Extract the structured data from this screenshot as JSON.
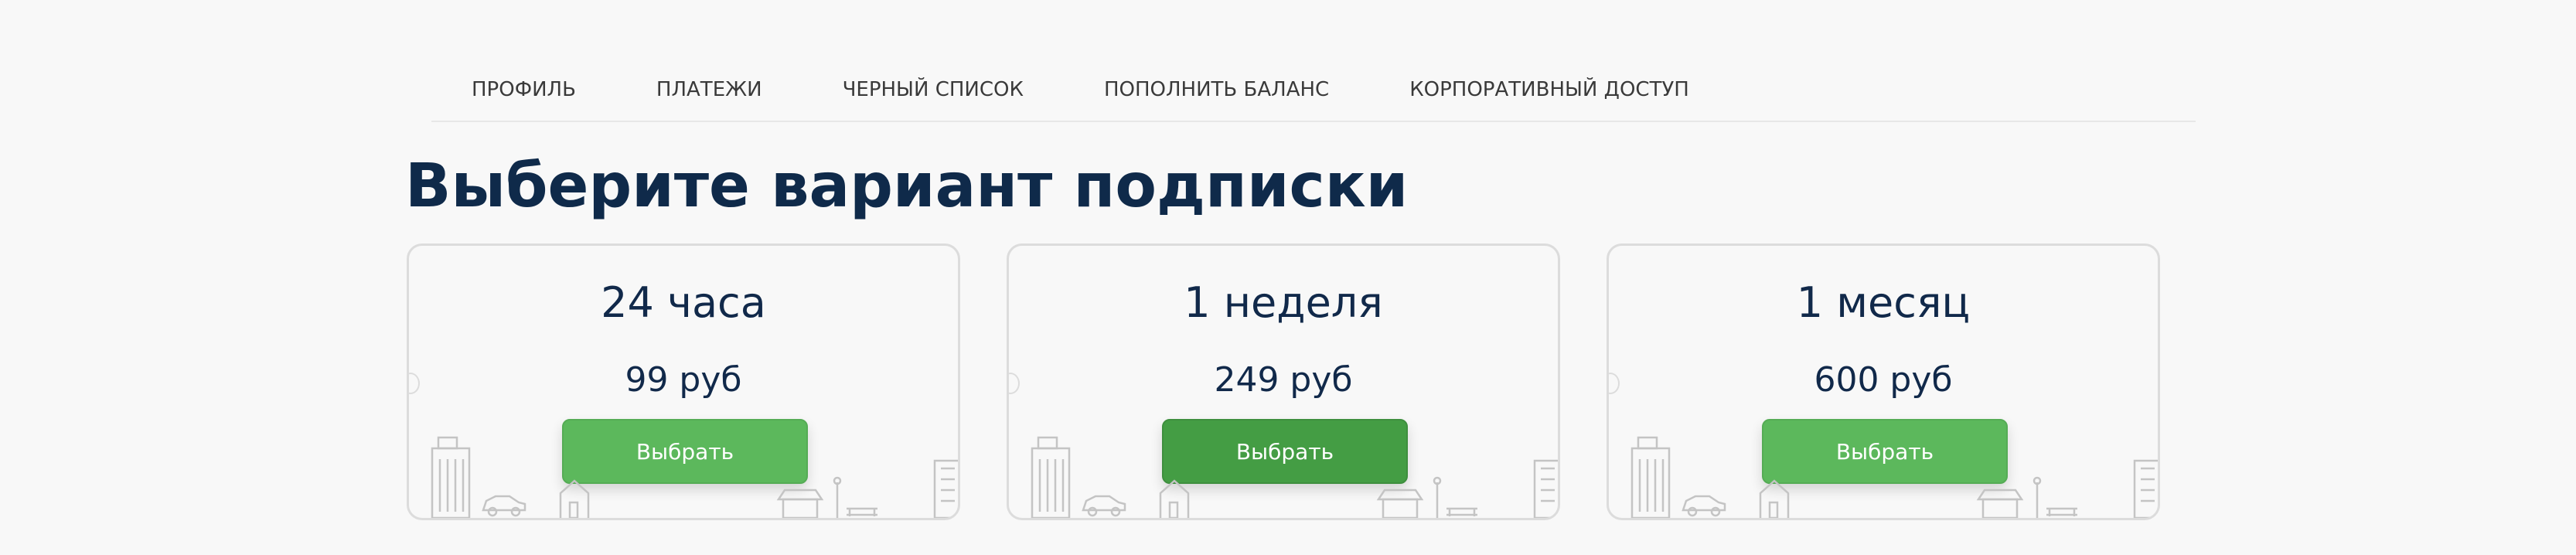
{
  "nav": {
    "tabs": [
      {
        "label": "ПРОФИЛЬ"
      },
      {
        "label": "ПЛАТЕЖИ"
      },
      {
        "label": "ЧЕРНЫЙ СПИСОК"
      },
      {
        "label": "ПОПОЛНИТЬ БАЛАНС"
      },
      {
        "label": "КОРПОРАТИВНЫЙ ДОСТУП"
      }
    ]
  },
  "title": "Выберите вариант подписки",
  "plans": [
    {
      "duration": "24 часа",
      "price": "99 руб",
      "button_label": "Выбрать"
    },
    {
      "duration": "1 неделя",
      "price": "249 руб",
      "button_label": "Выбрать"
    },
    {
      "duration": "1 месяц",
      "price": "600 руб",
      "button_label": "Выбрать"
    }
  ],
  "colors": {
    "background": "#f8f8f8",
    "title": "#0f2a4a",
    "button": "#5cb85c",
    "button_active": "#449d44",
    "card_border": "#dcdcdc",
    "illustration": "#c4c4c4"
  },
  "icons": [
    "building-icon",
    "car-icon",
    "house-icon",
    "kiosk-icon",
    "streetlamp-icon",
    "bench-icon",
    "tower-icon"
  ]
}
